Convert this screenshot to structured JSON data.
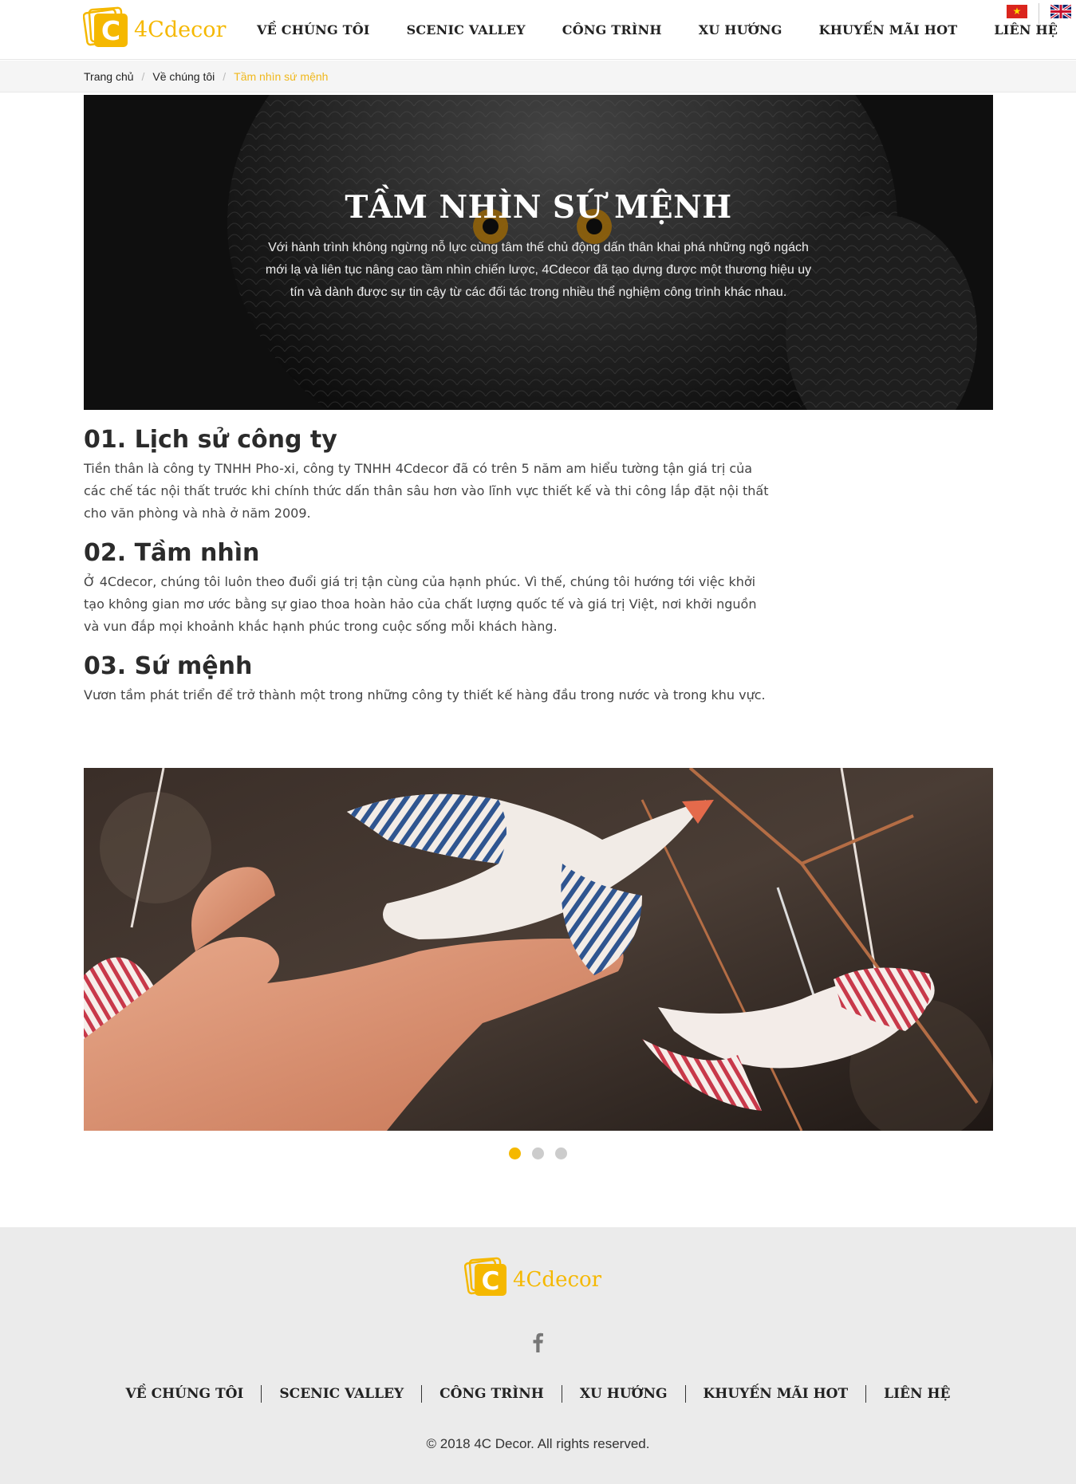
{
  "header": {
    "logo_text": "4Cdecor",
    "nav": [
      "VỀ CHÚNG TÔI",
      "SCENIC VALLEY",
      "CÔNG TRÌNH",
      "XU HƯỚNG",
      "KHUYẾN MÃI HOT",
      "LIÊN HỆ"
    ],
    "flags": [
      "vietnam-flag-icon",
      "uk-flag-icon"
    ]
  },
  "breadcrumb": {
    "home": "Trang chủ",
    "parent": "Về chúng tôi",
    "current": "Tầm nhìn sứ mệnh"
  },
  "hero": {
    "title": "TẦM NHÌN SỨ MỆNH",
    "text": "Với hành trình không ngừng nỗ lực cùng tâm thế chủ động dấn thân khai phá những ngõ ngách mới lạ và liên tục nâng cao tầm nhìn chiến lược, 4Cdecor đã tạo dựng được một thương hiệu uy tín và dành được sự tin cậy từ các đối tác trong nhiều thể nghiệm công trình khác nhau."
  },
  "sections": [
    {
      "heading": "01. Lịch sử công ty",
      "body": "Tiền thân là công ty TNHH Pho-xi, công ty TNHH 4Cdecor đã có trên 5 năm am hiểu tường tận giá trị của các chế tác nội thất trước khi chính thức dấn thân sâu hơn vào lĩnh vực thiết kế và thi công lắp đặt nội thất cho văn phòng và nhà ở năm 2009."
    },
    {
      "heading": "02. Tầm nhìn",
      "body": "Ở 4Cdecor, chúng tôi luôn theo đuổi giá trị tận cùng của hạnh phúc. Vì thế, chúng tôi hướng tới việc khởi tạo không gian mơ ước bằng sự giao thoa hoàn hảo của chất lượng quốc tế và giá trị Việt, nơi khởi nguồn và vun đắp mọi khoảnh khắc hạnh phúc trong cuộc sống mỗi khách hàng."
    },
    {
      "heading": "03. Sứ mệnh",
      "body": "Vươn tầm phát triển để trở thành một trong những công ty thiết kế hàng đầu trong nước và trong khu vực."
    }
  ],
  "slider": {
    "slide_count": 3,
    "active_index": 0
  },
  "footer": {
    "logo_text": "4Cdecor",
    "social": "facebook-icon",
    "nav": [
      "VỀ CHÚNG TÔI",
      "SCENIC VALLEY",
      "CÔNG TRÌNH",
      "XU HƯỚNG",
      "KHUYẾN MÃI HOT",
      "LIÊN HỆ"
    ],
    "copyright": "© 2018 4C Decor. All rights reserved."
  },
  "colors": {
    "accent": "#f0b81c",
    "footer_bg": "#ebebeb",
    "breadcrumb_bg": "#f5f5f5"
  }
}
